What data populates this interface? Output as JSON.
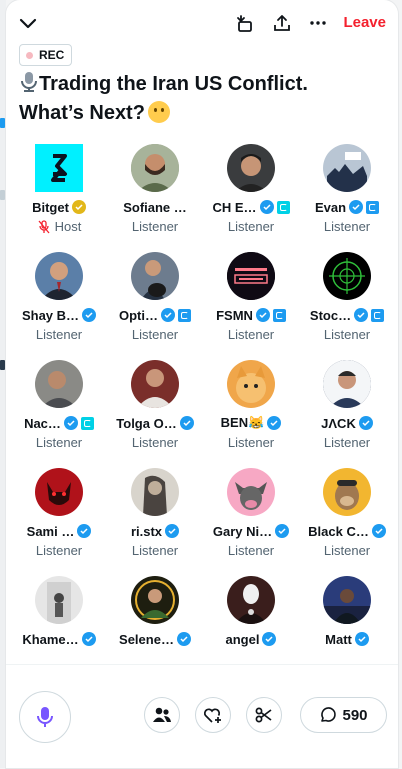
{
  "header": {
    "leave_label": "Leave",
    "rec_label": "REC",
    "title": "Trading the Iran US Conflict. What’s Next?"
  },
  "participants": [
    {
      "name": "Bitget",
      "role": "Host",
      "badge": "gold",
      "avatar": "bitget-logo"
    },
    {
      "name": "Sofiane …",
      "role": "Listener",
      "badge": "",
      "avatar": "man-beard"
    },
    {
      "name": "CH E…",
      "role": "Listener",
      "badge": "blue",
      "affiliate": "cyan",
      "avatar": "man-dark-hair"
    },
    {
      "name": "Evan",
      "role": "Listener",
      "badge": "blue",
      "affiliate": "blue",
      "avatar": "bull-bear"
    },
    {
      "name": "Shay B…",
      "role": "Listener",
      "badge": "blue",
      "avatar": "man-suit"
    },
    {
      "name": "Opti…",
      "role": "Listener",
      "badge": "blue",
      "affiliate": "blue",
      "avatar": "man-dog"
    },
    {
      "name": "FSMN",
      "role": "Listener",
      "badge": "blue",
      "affiliate": "blue",
      "avatar": "stock-market-news"
    },
    {
      "name": "Stoc…",
      "role": "Listener",
      "badge": "blue",
      "affiliate": "blue",
      "avatar": "radar"
    },
    {
      "name": "Nac…",
      "role": "Listener",
      "badge": "blue",
      "affiliate": "cyan",
      "avatar": "man-gray"
    },
    {
      "name": "Tolga O…",
      "role": "Listener",
      "badge": "blue",
      "avatar": "man-red"
    },
    {
      "name": "BEN😹",
      "role": "Listener",
      "badge": "blue",
      "avatar": "cat"
    },
    {
      "name": "JΛCK",
      "role": "Listener",
      "badge": "blue",
      "avatar": "man-smile"
    },
    {
      "name": "Sami …",
      "role": "Listener",
      "badge": "blue",
      "avatar": "red-wolf"
    },
    {
      "name": "ri.stx",
      "role": "Listener",
      "badge": "blue",
      "avatar": "sketch-woman"
    },
    {
      "name": "Gary Ni…",
      "role": "Listener",
      "badge": "blue",
      "avatar": "pink-bull"
    },
    {
      "name": "Black C…",
      "role": "Listener",
      "badge": "blue",
      "avatar": "ape"
    },
    {
      "name": "Khame…",
      "role": "",
      "badge": "blue",
      "avatar": "man-statue"
    },
    {
      "name": "Selene…",
      "role": "",
      "badge": "blue",
      "avatar": "woman-green"
    },
    {
      "name": "angel",
      "role": "",
      "badge": "blue",
      "avatar": "masked-woman"
    },
    {
      "name": "Matt",
      "role": "",
      "badge": "blue",
      "avatar": "man-night"
    }
  ],
  "footer": {
    "reply_count": "590"
  },
  "colors": {
    "leave": "#f4212e",
    "verified": "#1d9bf0",
    "gold": "#e2b719",
    "mic_purple": "#7856ff"
  }
}
